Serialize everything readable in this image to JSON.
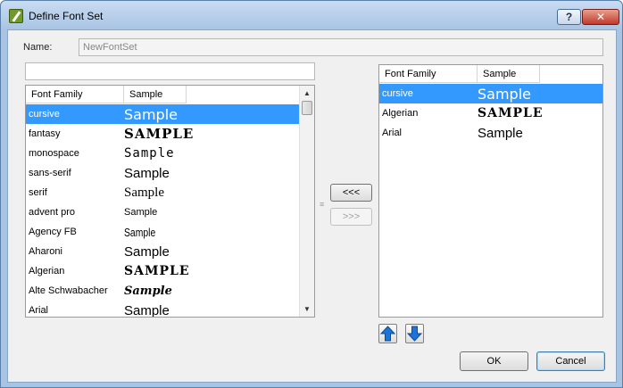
{
  "window": {
    "title": "Define Font Set",
    "help_label": "?",
    "close_label": "✕"
  },
  "name_field": {
    "label": "Name:",
    "value": "NewFontSet"
  },
  "filter": {
    "value": ""
  },
  "columns": {
    "family": "Font Family",
    "sample": "Sample"
  },
  "available_fonts": [
    {
      "family": "cursive",
      "sample": "Sample",
      "selected": true
    },
    {
      "family": "fantasy",
      "sample": "SAMPLE"
    },
    {
      "family": "monospace",
      "sample": "Sample"
    },
    {
      "family": "sans-serif",
      "sample": "Sample"
    },
    {
      "family": "serif",
      "sample": "Sample"
    },
    {
      "family": "advent pro",
      "sample": "Sample"
    },
    {
      "family": "Agency FB",
      "sample": "Sample"
    },
    {
      "family": "Aharoni",
      "sample": "Sample"
    },
    {
      "family": "Algerian",
      "sample": "SAMPLE"
    },
    {
      "family": "Alte Schwabacher",
      "sample": "Sample"
    },
    {
      "family": "Arial",
      "sample": "Sample"
    }
  ],
  "set_fonts": [
    {
      "family": "cursive",
      "sample": "Sample",
      "selected": true
    },
    {
      "family": "Algerian",
      "sample": "SAMPLE"
    },
    {
      "family": "Arial",
      "sample": "Sample"
    }
  ],
  "buttons": {
    "add": "<<<",
    "remove": ">>>",
    "ok": "OK",
    "cancel": "Cancel"
  },
  "colors": {
    "selection": "#3399ff",
    "move_arrow": "#1e73d6"
  }
}
